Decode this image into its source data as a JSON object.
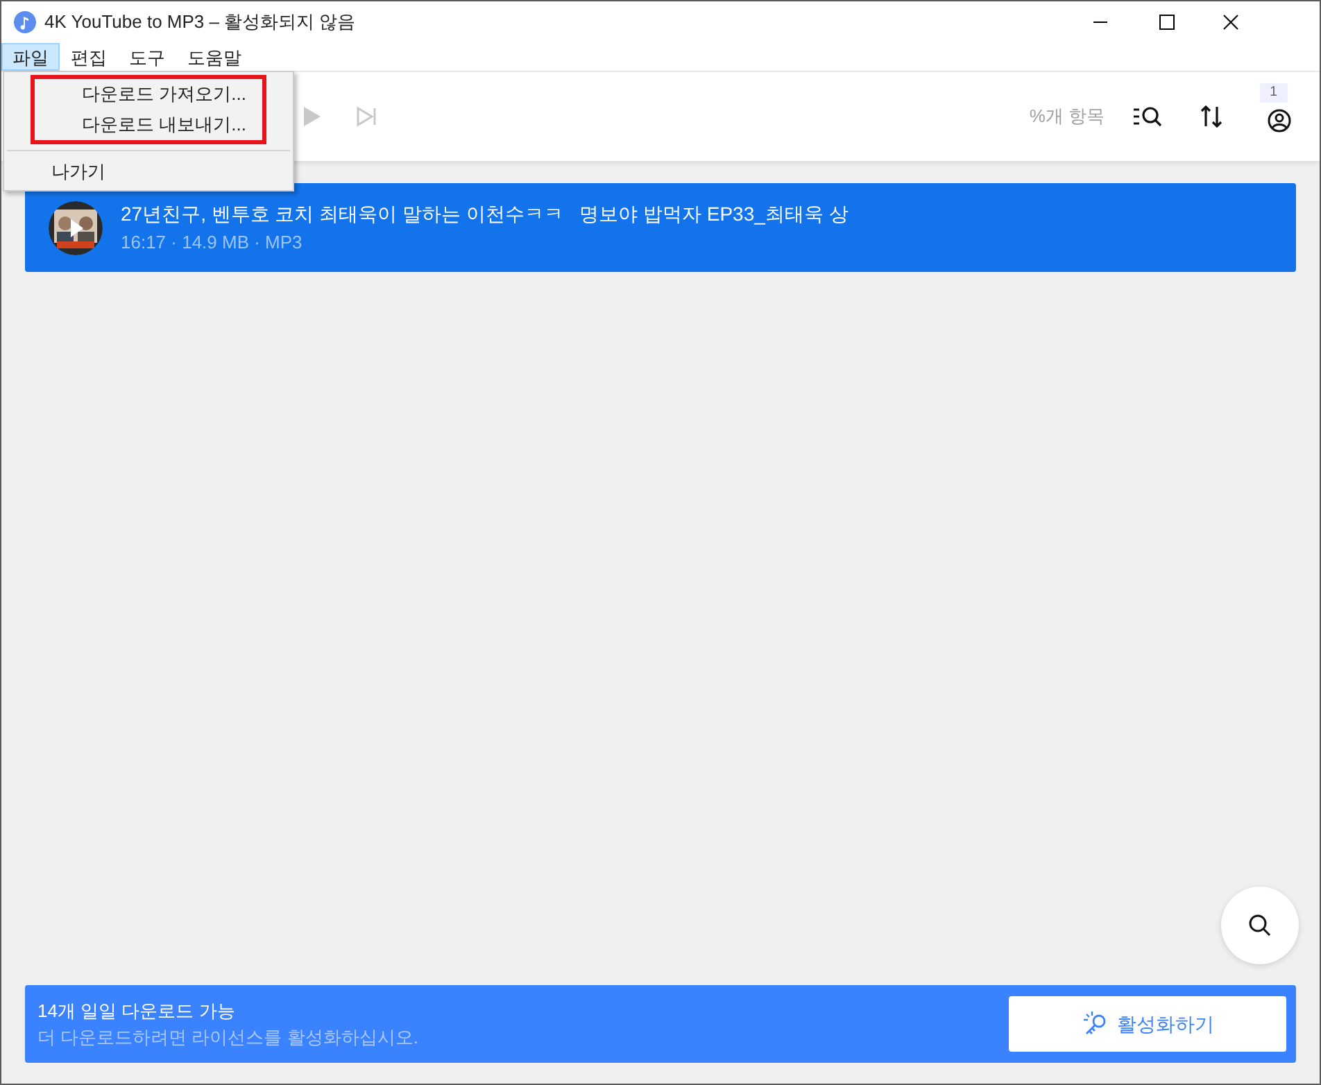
{
  "window": {
    "title": "4K YouTube to MP3 – 활성화되지 않음"
  },
  "menu_bar": [
    {
      "label": "파일",
      "selected": true
    },
    {
      "label": "편집",
      "selected": false
    },
    {
      "label": "도구",
      "selected": false
    },
    {
      "label": "도움말",
      "selected": false
    }
  ],
  "file_menu": {
    "items": [
      {
        "label": "다운로드 가져오기...",
        "highlighted": true
      },
      {
        "label": "다운로드 내보내기...",
        "highlighted": true
      },
      {
        "label": "나가기",
        "highlighted": false
      }
    ]
  },
  "toolbar": {
    "items_count": "%개 항목",
    "badge": "1"
  },
  "downloads": [
    {
      "title": "27년친구, 벤투호 코치 최태욱이 말하는 이천수ㅋㅋ   명보야 밥먹자 EP33_최태욱 상",
      "meta": "16:17 · 14.9 MB · MP3",
      "selected": true
    }
  ],
  "banner": {
    "title": "14개 일일 다운로드 가능",
    "subtitle": "더 다운로드하려면 라이선스를 활성화하십시오.",
    "button": "활성화하기"
  }
}
